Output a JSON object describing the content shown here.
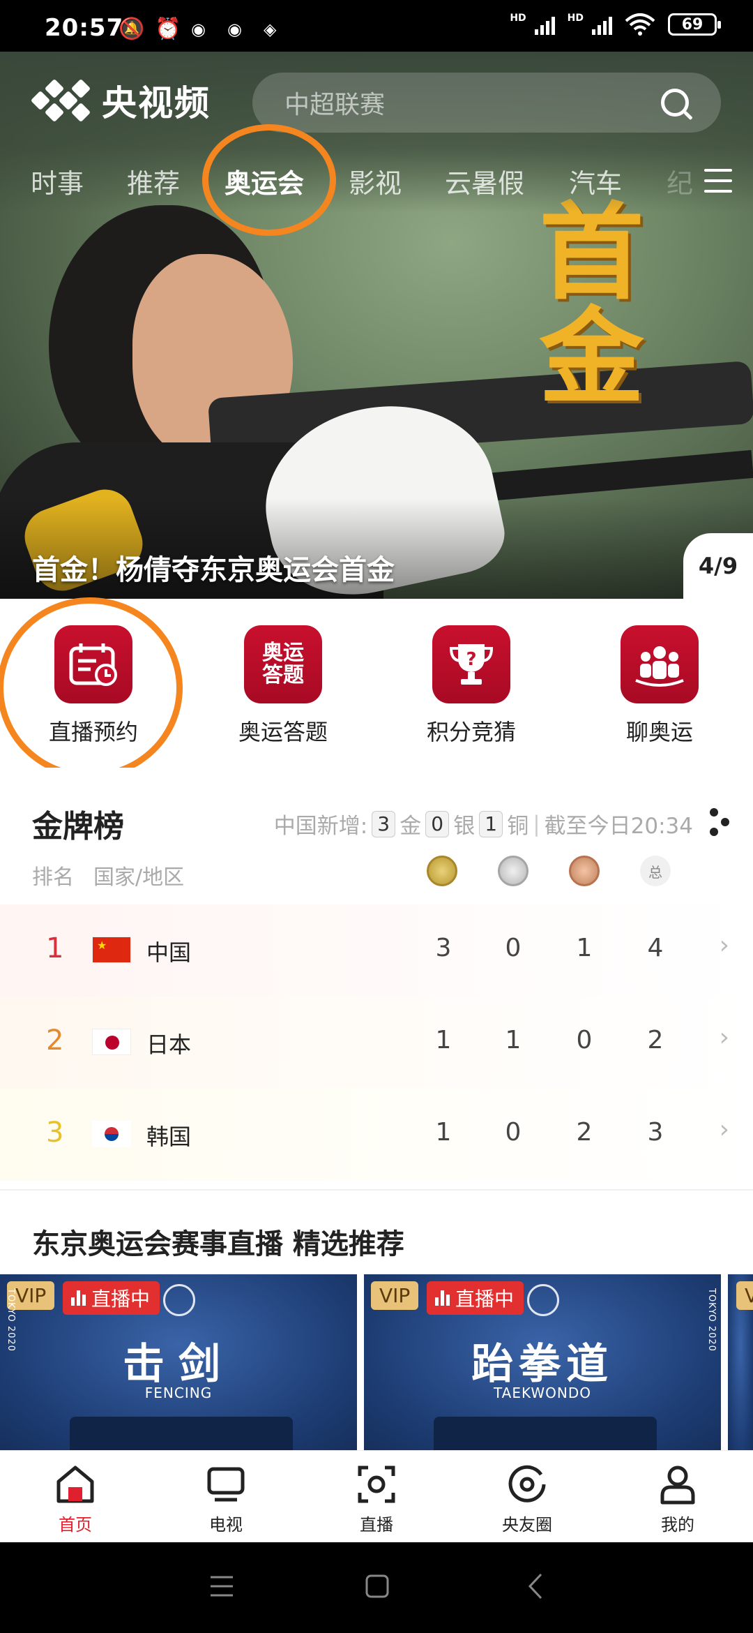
{
  "status_bar": {
    "time": "20:57",
    "battery": "69",
    "hd1": "HD",
    "hd2": "HD"
  },
  "app": {
    "logo_text": "央视频"
  },
  "search": {
    "placeholder": "中超联赛"
  },
  "tabs": [
    {
      "label": "时事"
    },
    {
      "label": "推荐"
    },
    {
      "label": "奥运会",
      "active": true
    },
    {
      "label": "影视"
    },
    {
      "label": "云暑假"
    },
    {
      "label": "汽车"
    },
    {
      "label": "纪"
    }
  ],
  "hero": {
    "overlay_text": "首金",
    "caption": "首金！杨倩夺东京奥运会首金",
    "pager": "4/9"
  },
  "quick_actions": [
    {
      "label": "直播预约",
      "icon": "calendar-clock-icon"
    },
    {
      "label": "奥运答题",
      "icon": "quiz-icon",
      "icon_text": "奥运答题"
    },
    {
      "label": "积分竞猜",
      "icon": "trophy-question-icon"
    },
    {
      "label": "聊奥运",
      "icon": "group-chat-icon"
    }
  ],
  "medal_board": {
    "title": "金牌榜",
    "info_prefix": "中国新增:",
    "gold_new": "3",
    "gold_word": "金",
    "silver_new": "0",
    "silver_word": "银",
    "bronze_new": "1",
    "bronze_word": "铜",
    "updated": "截至今日20:34",
    "col_rank": "排名",
    "col_country": "国家/地区",
    "col_total": "总",
    "rows": [
      {
        "rank": "1",
        "country": "中国",
        "gold": "3",
        "silver": "0",
        "bronze": "1",
        "total": "4"
      },
      {
        "rank": "2",
        "country": "日本",
        "gold": "1",
        "silver": "1",
        "bronze": "0",
        "total": "2"
      },
      {
        "rank": "3",
        "country": "韩国",
        "gold": "1",
        "silver": "0",
        "bronze": "2",
        "total": "3"
      }
    ]
  },
  "recommend": {
    "title": "东京奥运会赛事直播 精选推荐",
    "cards": [
      {
        "vip": "VIP",
        "live": "直播中",
        "sport": "击剑",
        "sport_en": "FENCING",
        "tokyo": "TOKYO 2020"
      },
      {
        "vip": "VIP",
        "live": "直播中",
        "sport": "跆拳道",
        "sport_en": "TAEKWONDO",
        "tokyo": "TOKYO 2020"
      },
      {
        "vip": "VIP"
      }
    ]
  },
  "bottom_nav": [
    {
      "label": "首页",
      "active": true
    },
    {
      "label": "电视"
    },
    {
      "label": "直播"
    },
    {
      "label": "央友圈"
    },
    {
      "label": "我的"
    }
  ],
  "colors": {
    "accent": "#e0202e",
    "brand_red": "#c8102e",
    "highlight_ring": "#f5861f",
    "gold": "#f0b227"
  }
}
